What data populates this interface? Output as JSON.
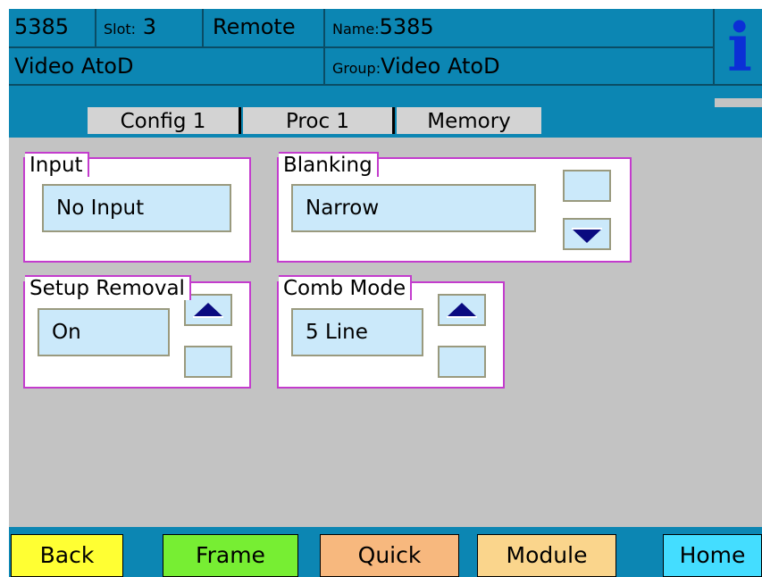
{
  "header": {
    "card_id": "5385",
    "slot_label": "Slot:",
    "slot_value": "3",
    "mode": "Remote",
    "name_label": "Name:",
    "name_value": "5385",
    "subtitle": "Video AtoD",
    "group_label": "Group:",
    "group_value": "Video AtoD",
    "info_icon": "i"
  },
  "tabs": [
    {
      "label": "Config 1"
    },
    {
      "label": "Proc 1"
    },
    {
      "label": "Memory"
    }
  ],
  "panels": {
    "input": {
      "label": "Input",
      "value": "No Input"
    },
    "blanking": {
      "label": "Blanking",
      "value": "Narrow"
    },
    "setup_removal": {
      "label": "Setup Removal",
      "value": "On"
    },
    "comb_mode": {
      "label": "Comb Mode",
      "value": "5 Line"
    }
  },
  "footer": {
    "buttons": [
      {
        "label": "Back",
        "color": "#ffff33"
      },
      {
        "label": "Frame",
        "color": "#77ee33"
      },
      {
        "label": "Quick",
        "color": "#f7b87e"
      },
      {
        "label": "Module",
        "color": "#fad58c"
      },
      {
        "label": "Home",
        "color": "#44ddff"
      }
    ]
  },
  "colors": {
    "header_bg": "#0c86b3",
    "panel_border": "#c33ccd",
    "field_bg": "#cbe9fa",
    "arrow": "#0a0a80"
  },
  "icons": {
    "info": "info-icon",
    "up": "up-arrow-icon",
    "down": "down-arrow-icon"
  }
}
